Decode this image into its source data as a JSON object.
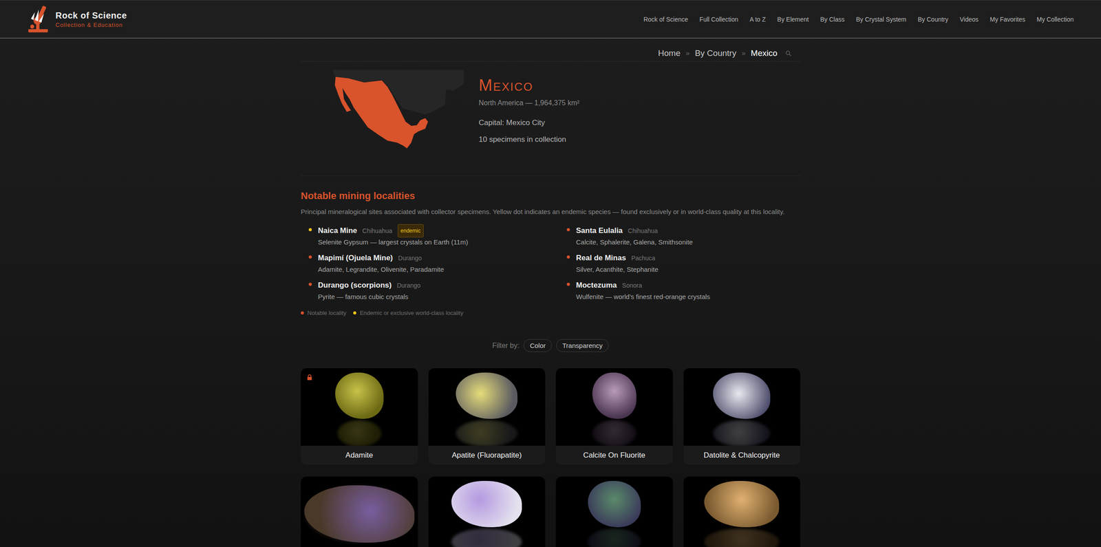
{
  "header": {
    "logo": {
      "title": "Rock of Science",
      "subtitle": "Collection & Education"
    },
    "nav": [
      {
        "label": "Rock of Science",
        "selected": false
      },
      {
        "label": "Full Collection",
        "selected": false
      },
      {
        "label": "A to Z",
        "selected": false
      },
      {
        "label": "By Element",
        "selected": false
      },
      {
        "label": "By Class",
        "selected": false
      },
      {
        "label": "By Crystal System",
        "selected": false
      },
      {
        "label": "By Country",
        "selected": false
      },
      {
        "label": "Videos",
        "selected": false
      },
      {
        "label": "My Favorites",
        "selected": false
      },
      {
        "label": "My Collection",
        "selected": false
      }
    ]
  },
  "breadcrumb": {
    "separator": "»",
    "items": [
      {
        "label": "Home",
        "selected": false
      },
      {
        "label": "By Country",
        "selected": false
      },
      {
        "label": "Mexico",
        "selected": true
      }
    ]
  },
  "country": {
    "name": "Mexico",
    "region": "North America — 1,964,375 km²",
    "capital": "Capital: Mexico City",
    "count": "10 specimens in collection"
  },
  "localities": {
    "title": "Notable mining localities",
    "description": "Principal mineralogical sites associated with collector specimens. Yellow dot indicates an endemic species — found exclusively or in world-class quality at this locality.",
    "items": [
      {
        "name": "Naica Mine",
        "region": "Chihuahua",
        "badge": "endemic",
        "description": "Selenite Gypsum — largest crystals on Earth (11m)",
        "endemic": true
      },
      {
        "name": "Santa Eulalia",
        "region": "Chihuahua",
        "description": "Calcite, Sphalerite, Galena, Smithsonite",
        "endemic": false
      },
      {
        "name": "Mapimí (Ojuela Mine)",
        "region": "Durango",
        "description": "Adamite, Legrandite, Olivenite, Paradamite",
        "endemic": false
      },
      {
        "name": "Real de Minas",
        "region": "Pachuca",
        "description": "Silver, Acanthite, Stephanite",
        "endemic": false
      },
      {
        "name": "Durango (scorpions)",
        "region": "Durango",
        "description": "Pyrite — famous cubic crystals",
        "endemic": false
      },
      {
        "name": "Moctezuma",
        "region": "Sonora",
        "description": "Wulfenite — world's finest red-orange crystals",
        "endemic": false
      }
    ],
    "legend": [
      {
        "label": "Notable locality",
        "color": "#d9532c"
      },
      {
        "label": "Endemic or exclusive world-class locality",
        "color": "#f0c419"
      }
    ]
  },
  "filters": {
    "label": "Filter by:",
    "options": [
      "Color",
      "Transparency"
    ]
  },
  "specimens": [
    {
      "label": "Adamite",
      "locked": true
    },
    {
      "label": "Apatite (Fluorapatite)",
      "locked": false
    },
    {
      "label": "Calcite On Fluorite",
      "locked": false
    },
    {
      "label": "Datolite & Chalcopyrite",
      "locked": false
    },
    {
      "locked": false
    },
    {
      "locked": false
    },
    {
      "locked": false
    },
    {
      "locked": false
    }
  ]
}
